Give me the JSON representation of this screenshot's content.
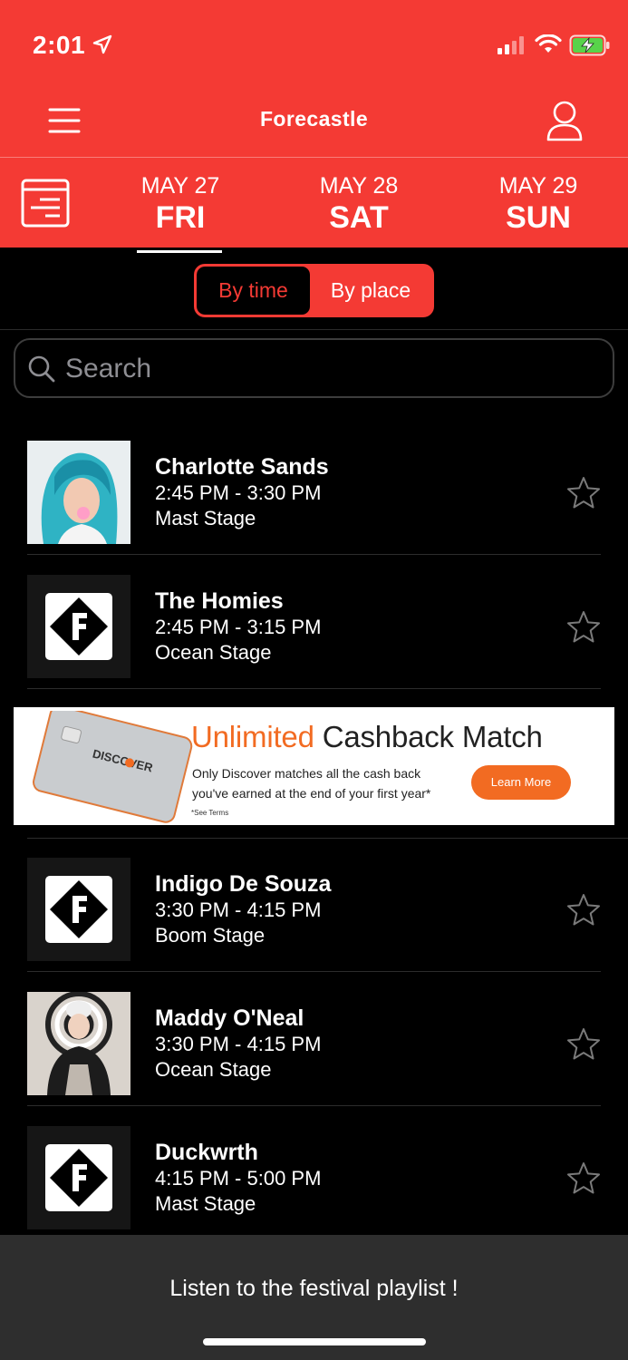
{
  "status": {
    "time": "2:01"
  },
  "header": {
    "title": "Forecastle"
  },
  "days": [
    {
      "date": "MAY 27",
      "name": "FRI"
    },
    {
      "date": "MAY 28",
      "name": "SAT"
    },
    {
      "date": "MAY 29",
      "name": "SUN"
    }
  ],
  "view_toggle": {
    "by_time": "By time",
    "by_place": "By place"
  },
  "search": {
    "placeholder": "Search"
  },
  "performances": [
    {
      "artist": "Charlotte Sands",
      "time": "2:45 PM - 3:30 PM",
      "stage": "Mast Stage",
      "thumb": "artist-photo"
    },
    {
      "artist": "The Homies",
      "time": "2:45 PM - 3:15 PM",
      "stage": "Ocean Stage",
      "thumb": "festival-logo"
    },
    {
      "artist": "Indigo De Souza",
      "time": "3:30 PM - 4:15 PM",
      "stage": "Boom Stage",
      "thumb": "festival-logo"
    },
    {
      "artist": "Maddy O'Neal",
      "time": "3:30 PM - 4:15 PM",
      "stage": "Ocean Stage",
      "thumb": "artist-photo"
    },
    {
      "artist": "Duckwrth",
      "time": "4:15 PM - 5:00 PM",
      "stage": "Mast Stage",
      "thumb": "festival-logo"
    }
  ],
  "ad": {
    "headline_highlight": "Unlimited",
    "headline_rest": "Cashback Match",
    "line1": "Only Discover matches all the cash back",
    "line2": "you've earned at the end of your first year*",
    "terms": "*See Terms",
    "cta": "Learn More",
    "card_brand": "DISCOVER"
  },
  "footer": {
    "playlist_label": "Listen to the festival playlist !"
  },
  "colors": {
    "brand_red": "#f43a34",
    "ad_orange": "#f26b22",
    "background": "#000000"
  }
}
